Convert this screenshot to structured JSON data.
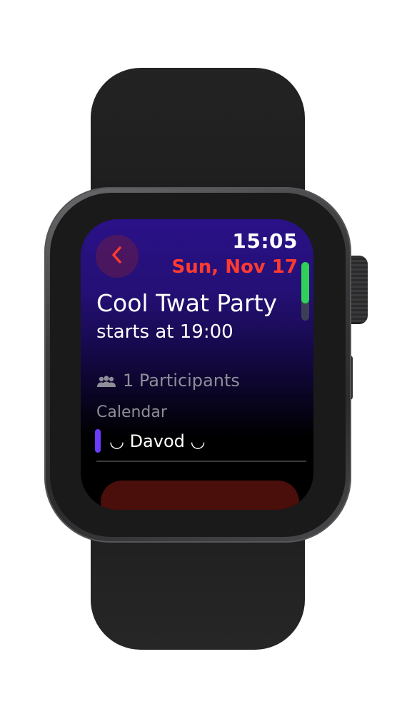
{
  "status": {
    "time": "15:05",
    "date": "Sun, Nov 17"
  },
  "event": {
    "title": "Cool Twat Party",
    "subtitle": "starts at 19:00",
    "participants": "1 Participants",
    "calendar_label": "Calendar",
    "calendar_name": "◡ Davod ◡"
  },
  "colors": {
    "accent": "#ff3b30",
    "calendar": "#6a3cff",
    "scroll": "#30d158"
  },
  "icons": {
    "back": "chevron-left-icon",
    "participants": "people-icon"
  }
}
